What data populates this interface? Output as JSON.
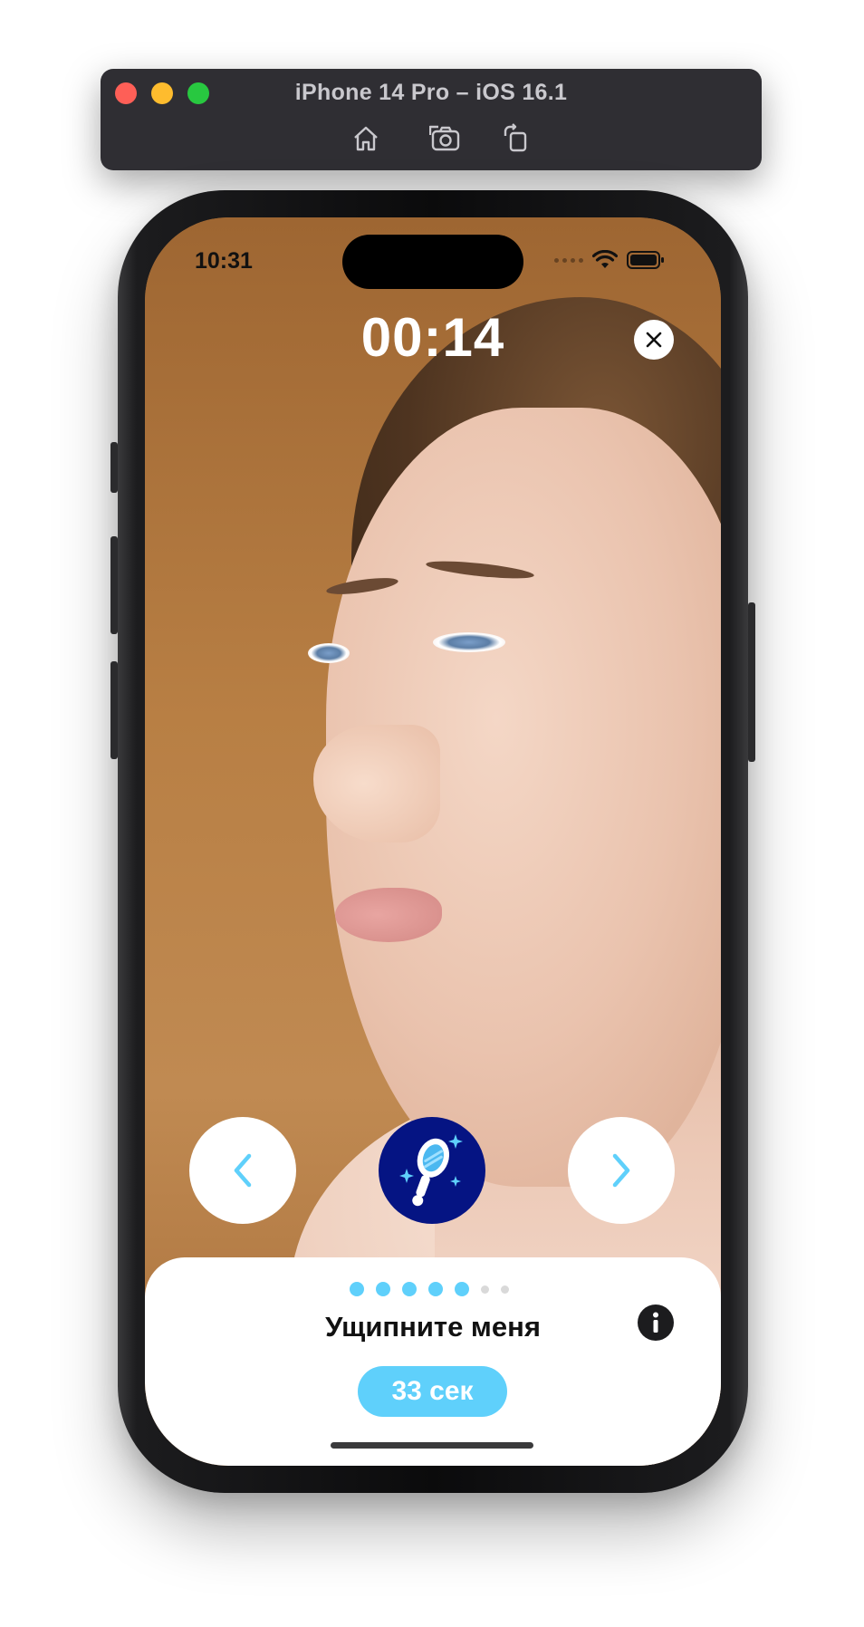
{
  "simulator": {
    "title": "iPhone 14 Pro – iOS 16.1",
    "toolbar": [
      {
        "name": "home-icon",
        "label": "Home"
      },
      {
        "name": "screenshot-icon",
        "label": "Screenshot"
      },
      {
        "name": "rotate-icon",
        "label": "Rotate"
      }
    ]
  },
  "status_bar": {
    "time": "10:31"
  },
  "workout": {
    "timer": "00:14",
    "exercise_title": "Ущипните меня",
    "duration": "33 сек",
    "center_icon": "hand-mirror-sparkle-icon",
    "progress": {
      "total_steps": 7,
      "completed_steps": 5
    }
  },
  "colors": {
    "accent": "#5fd0fb",
    "badge": "#051483",
    "dot_inactive": "#d9d9d9"
  }
}
